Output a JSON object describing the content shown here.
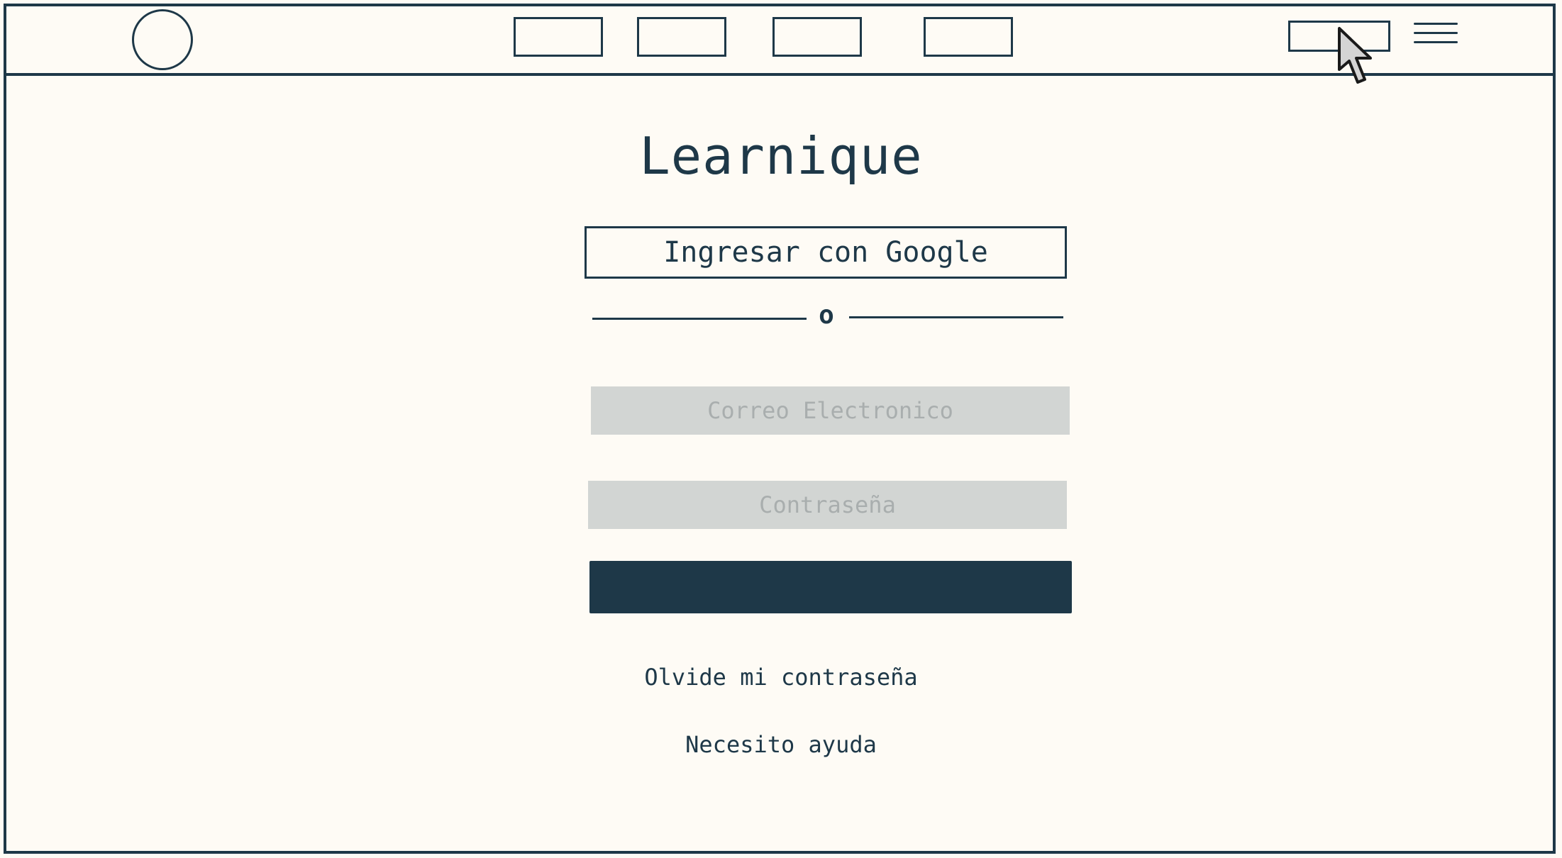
{
  "app": {
    "title": "Learnique"
  },
  "header": {
    "nav_items": [
      "",
      "",
      "",
      ""
    ],
    "menu_icon": "hamburger-menu-icon"
  },
  "login": {
    "google_button_label": "Ingresar con Google",
    "separator_text": "o",
    "email_placeholder": "Correo Electronico",
    "password_placeholder": "Contraseña",
    "submit_label": "",
    "forgot_password": "Olvide mi contraseña",
    "help": "Necesito ayuda"
  },
  "colors": {
    "ink": "#1e3848",
    "background": "#fefbf5",
    "input_fill": "#d2d5d3",
    "placeholder": "#a9aeae"
  }
}
